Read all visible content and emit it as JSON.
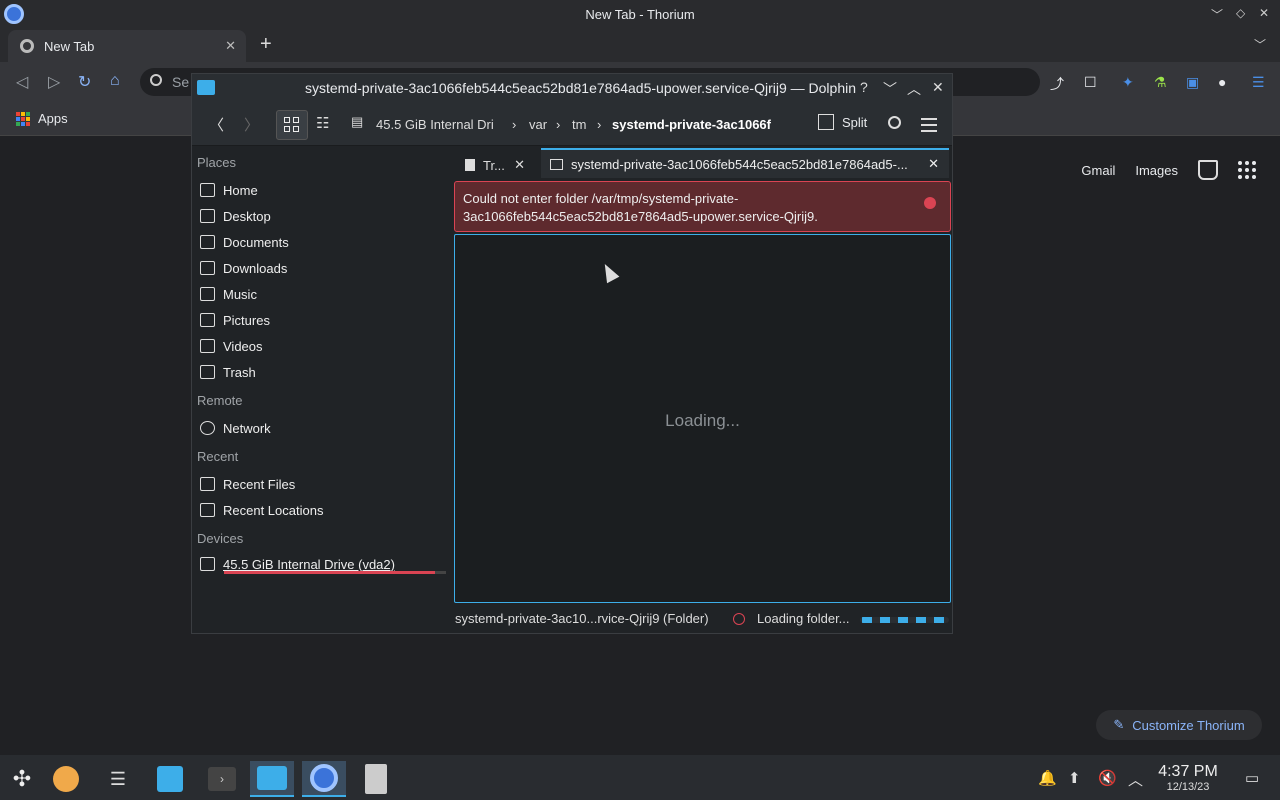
{
  "browser": {
    "window_title": "New Tab - Thorium",
    "tab_title": "New Tab",
    "omnibox_placeholder": "Se",
    "bookmarks_apps": "Apps",
    "ntp_links": [
      "Gmail",
      "Images"
    ],
    "customize_label": "Customize Thorium"
  },
  "dolphin": {
    "window_title": "systemd-private-3ac1066feb544c5eac52bd81e7864ad5-upower.service-Qjrij9 — Dolphin",
    "breadcrumbs": [
      "45.5 GiB Internal Dri",
      "var",
      "tm",
      "systemd-private-3ac1066f"
    ],
    "split_label": "Split",
    "places": {
      "sections": [
        "Places",
        "Remote",
        "Recent",
        "Devices"
      ],
      "places_items": [
        "Home",
        "Desktop",
        "Documents",
        "Downloads",
        "Music",
        "Pictures",
        "Videos",
        "Trash"
      ],
      "remote_items": [
        "Network"
      ],
      "recent_items": [
        "Recent Files",
        "Recent Locations"
      ],
      "device_items": [
        "45.5 GiB Internal Drive (vda2)"
      ],
      "drive_usage_fraction": 0.95
    },
    "tabs": [
      "Tr...",
      "systemd-private-3ac1066feb544c5eac52bd81e7864ad5-..."
    ],
    "error_message": "Could not enter folder /var/tmp/systemd-private-3ac1066feb544c5eac52bd81e7864ad5-upower.service-Qjrij9.",
    "loading_text": "Loading...",
    "status_info": "systemd-private-3ac10...rvice-Qjrij9 (Folder)",
    "status_loading": "Loading folder..."
  },
  "taskbar": {
    "time": "4:37 PM",
    "date": "12/13/23"
  },
  "colors": {
    "accent": "#3daee9",
    "error": "#da4453",
    "link": "#8ab4f8"
  }
}
